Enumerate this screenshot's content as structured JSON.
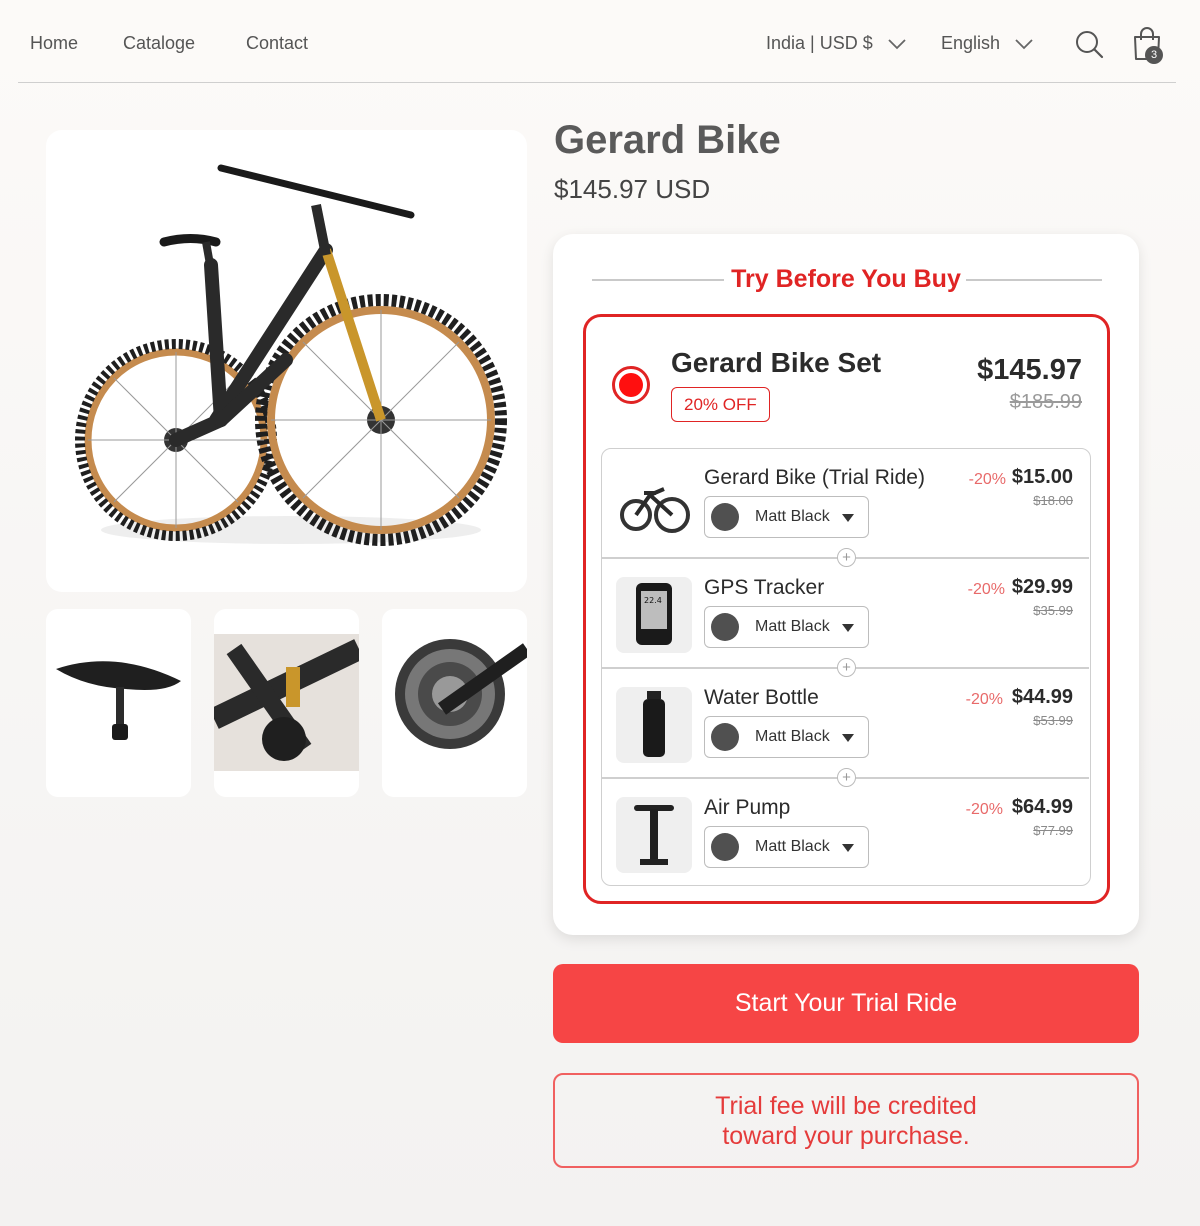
{
  "header": {
    "nav": [
      {
        "label": "Home"
      },
      {
        "label": "Cataloge"
      },
      {
        "label": "Contact"
      }
    ],
    "locale": "India | USD $",
    "language": "English",
    "cart_count": "3"
  },
  "product": {
    "title": "Gerard Bike",
    "price": "$145.97 USD"
  },
  "offer": {
    "heading": "Try Before You Buy",
    "bundle": {
      "name": "Gerard Bike Set",
      "discount": "20% OFF",
      "price": "$145.97",
      "compare_price": "$185.99",
      "selected": true
    },
    "items": [
      {
        "name": "Gerard Bike (Trial Ride)",
        "variant": "Matt Black",
        "off": "-20%",
        "price": "$15.00",
        "compare": "$18.00",
        "icon": "bike-icon"
      },
      {
        "name": "GPS Tracker",
        "variant": "Matt Black",
        "off": "-20%",
        "price": "$29.99",
        "compare": "$35.99",
        "icon": "gps-icon"
      },
      {
        "name": "Water Bottle",
        "variant": "Matt Black",
        "off": "-20%",
        "price": "$44.99",
        "compare": "$53.99",
        "icon": "bottle-icon"
      },
      {
        "name": "Air Pump",
        "variant": "Matt Black",
        "off": "-20%",
        "price": "$64.99",
        "compare": "$77.99",
        "icon": "pump-icon"
      }
    ]
  },
  "cta": {
    "label": "Start Your Trial Ride"
  },
  "note": "Trial fee will be credited toward your purchase.",
  "colors": {
    "accent": "#e02424",
    "cta": "#f64545",
    "swatch_matt_black": "#505050"
  }
}
